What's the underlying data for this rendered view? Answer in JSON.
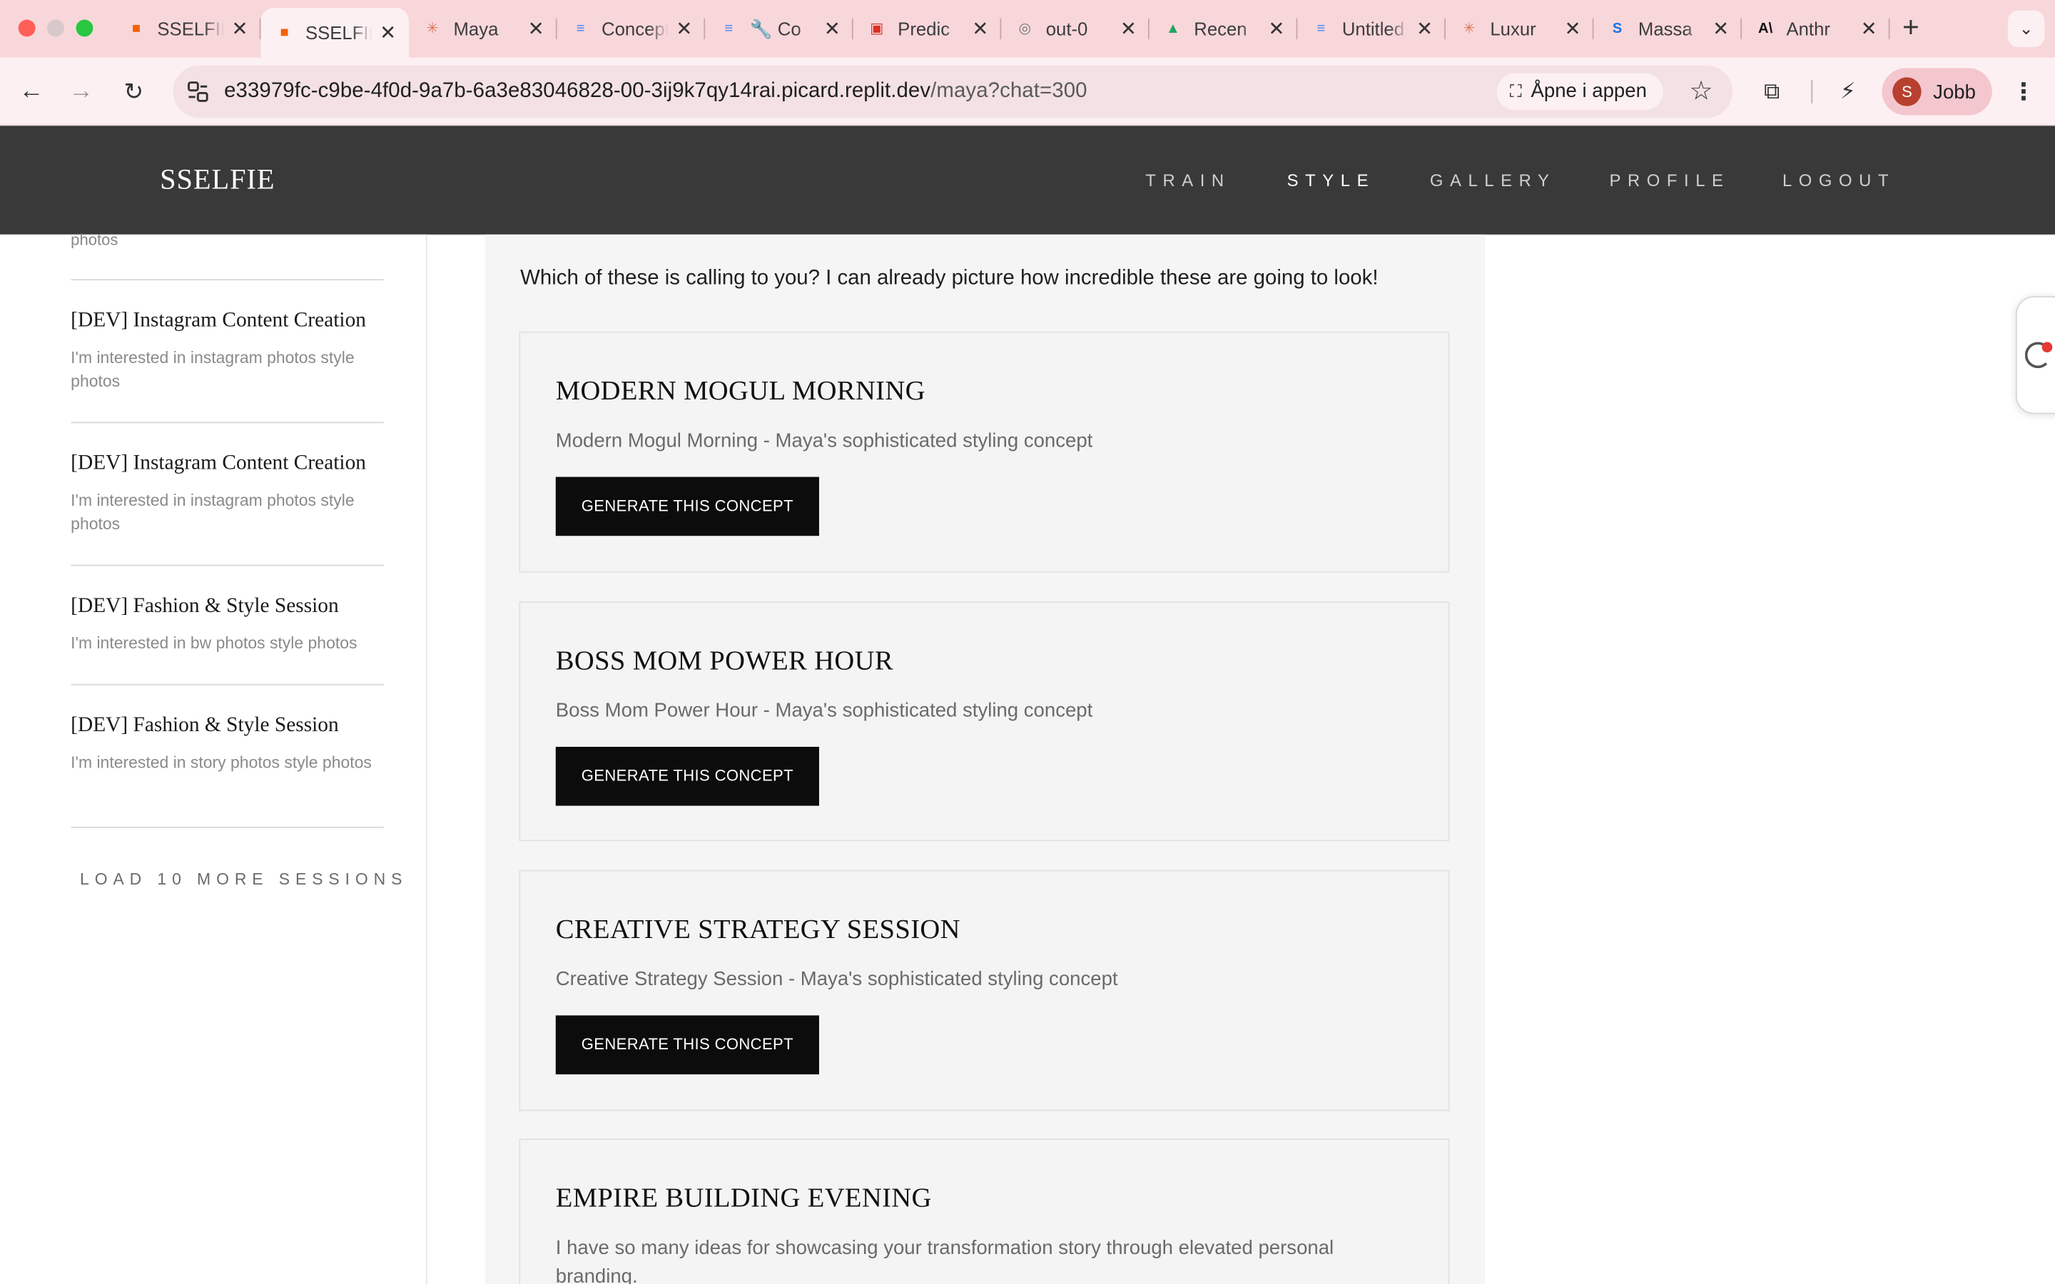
{
  "browser": {
    "tabs": [
      {
        "title": "SSELFIE",
        "favicon": "replit-icon",
        "active": false
      },
      {
        "title": "SSELFIE",
        "favicon": "replit-icon",
        "active": true
      },
      {
        "title": "Maya",
        "favicon": "claude-icon",
        "active": false
      },
      {
        "title": "Concept",
        "favicon": "google-docs-icon",
        "active": false
      },
      {
        "title": "🔧 Co",
        "favicon": "google-docs-icon",
        "active": false
      },
      {
        "title": "Predic",
        "favicon": "slides-icon",
        "active": false
      },
      {
        "title": "out-0",
        "favicon": "globe-icon",
        "active": false
      },
      {
        "title": "Recen",
        "favicon": "google-drive-icon",
        "active": false
      },
      {
        "title": "Untitled",
        "favicon": "google-docs-icon",
        "active": false
      },
      {
        "title": "Luxur",
        "favicon": "claude-icon",
        "active": false
      },
      {
        "title": "Massa",
        "favicon": "s-logo-icon",
        "active": false
      },
      {
        "title": "Anthr",
        "favicon": "anthropic-icon",
        "active": false
      }
    ],
    "url_host": "e33979fc-c9be-4f0d-9a7b-6a3e83046828-00-3ij9k7qy14rai.picard.replit.dev",
    "url_path": "/maya?chat=300",
    "open_in_app": "Åpne i appen",
    "profile_initial": "S",
    "profile_name": "Jobb"
  },
  "site": {
    "logo": "SSELFIE",
    "nav": [
      "TRAIN",
      "STYLE",
      "GALLERY",
      "PROFILE",
      "LOGOUT"
    ],
    "active_nav": "STYLE"
  },
  "sidebar": {
    "top_partial_text": "photos",
    "sessions": [
      {
        "title": "[DEV] Instagram Content Creation",
        "subtitle": "I'm interested in instagram photos style photos"
      },
      {
        "title": "[DEV] Instagram Content Creation",
        "subtitle": "I'm interested in instagram photos style photos"
      },
      {
        "title": "[DEV] Fashion & Style Session",
        "subtitle": "I'm interested in bw photos style photos"
      },
      {
        "title": "[DEV] Fashion & Style Session",
        "subtitle": "I'm interested in story photos style photos"
      }
    ],
    "load_more": "LOAD 10 MORE SESSIONS"
  },
  "chat": {
    "intro": "Which of these is calling to you? I can already picture how incredible these are going to look!",
    "concepts": [
      {
        "title": "MODERN MOGUL MORNING",
        "description": "Modern Mogul Morning - Maya's sophisticated styling concept",
        "button": "GENERATE THIS CONCEPT"
      },
      {
        "title": "BOSS MOM POWER HOUR",
        "description": "Boss Mom Power Hour - Maya's sophisticated styling concept",
        "button": "GENERATE THIS CONCEPT"
      },
      {
        "title": "CREATIVE STRATEGY SESSION",
        "description": "Creative Strategy Session - Maya's sophisticated styling concept",
        "button": "GENERATE THIS CONCEPT"
      },
      {
        "title": "EMPIRE BUILDING EVENING",
        "description": "I have so many ideas for showcasing your transformation story through elevated personal branding.",
        "button": ""
      }
    ]
  },
  "colors": {
    "tabstrip": "#f8d7db",
    "toolbar": "#fdf0f2",
    "site_header": "#393939",
    "button": "#0c0c0c",
    "chat_bg": "#f5f5f5"
  }
}
